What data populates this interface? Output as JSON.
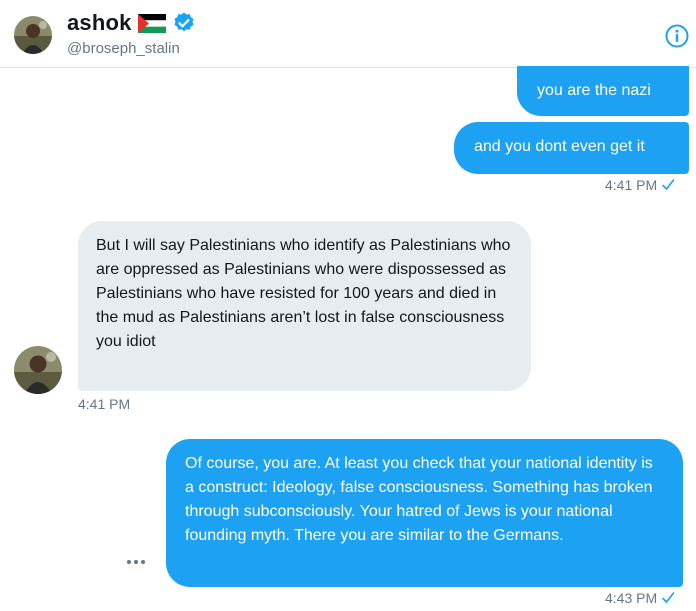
{
  "header": {
    "display_name": "ashok",
    "handle": "@broseph_stalin",
    "flag_icon": "palestine-flag-icon",
    "verified_icon": "verified-badge-icon",
    "info_icon": "info-icon"
  },
  "colors": {
    "accent": "#1da1f2",
    "incoming_bubble": "#e6ecf0",
    "text_primary": "#14171a",
    "text_secondary": "#657786"
  },
  "messages": [
    {
      "direction": "outgoing",
      "text": "you are the nazi"
    },
    {
      "direction": "outgoing",
      "text": "and you dont even get it",
      "time": "4:41 PM"
    },
    {
      "direction": "incoming",
      "text": "But I will say Palestinians who identify as Palestinians who are oppressed as Palestinians who were dispossessed as Palestinians who have resisted for 100 years and died in the mud as Palestinians aren’t lost in false consciousness you idiot",
      "time": "4:41 PM"
    },
    {
      "direction": "outgoing",
      "text": "Of course, you are. At least you check that your national identity is a construct: Ideology, false consciousness. Something has broken through subconsciously. Your hatred of Jews is your national founding myth. There you are similar to the Germans.",
      "time": "4:43 PM"
    }
  ],
  "more_icon": "more-options-icon"
}
